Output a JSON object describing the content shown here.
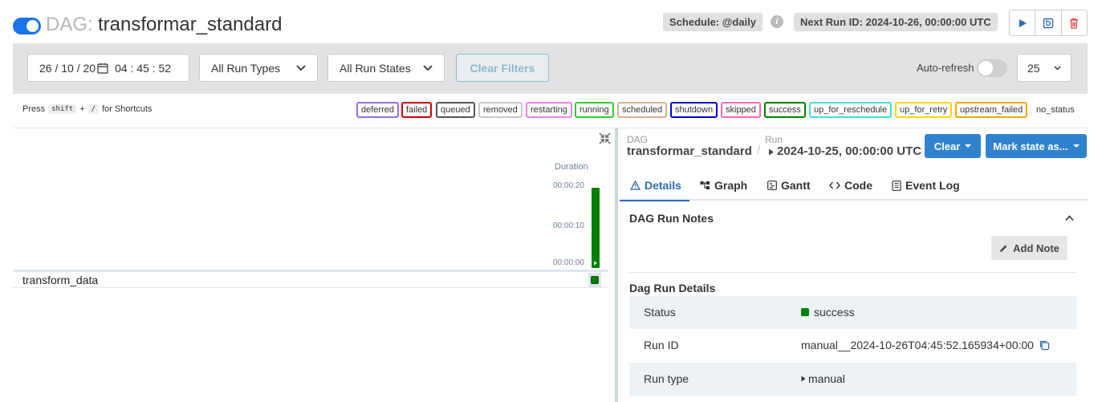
{
  "header": {
    "dag_prefix": "DAG:",
    "dag_id": "transformar_standard",
    "schedule": "Schedule: @daily",
    "next_run": "Next Run ID: 2024-10-26, 00:00:00 UTC",
    "actions": [
      "play-icon",
      "reparse-icon",
      "trash-icon"
    ]
  },
  "filters": {
    "date": "26 / 10 / 20",
    "time": "04 : 45 : 52",
    "run_types": "All Run Types",
    "run_states": "All Run States",
    "clear_filters": "Clear Filters",
    "auto_refresh_label": "Auto-refresh",
    "page_size": "25"
  },
  "shortcut": {
    "press": "Press",
    "key1": "shift",
    "plus": "+",
    "key2": "/",
    "suffix": "for Shortcuts"
  },
  "legend": [
    {
      "label": "deferred",
      "color": "#9370db"
    },
    {
      "label": "failed",
      "color": "#cc0000"
    },
    {
      "label": "queued",
      "color": "#555555"
    },
    {
      "label": "removed",
      "color": "#c8c8c8"
    },
    {
      "label": "restarting",
      "color": "#ee82ee"
    },
    {
      "label": "running",
      "color": "#32cd32"
    },
    {
      "label": "scheduled",
      "color": "#d2b48c"
    },
    {
      "label": "shutdown",
      "color": "#0000cc"
    },
    {
      "label": "skipped",
      "color": "#ff69b4"
    },
    {
      "label": "success",
      "color": "#008000"
    },
    {
      "label": "up_for_reschedule",
      "color": "#40e0d0"
    },
    {
      "label": "up_for_retry",
      "color": "#ffd700"
    },
    {
      "label": "upstream_failed",
      "color": "#ffa500"
    },
    {
      "label": "no_status",
      "color": ""
    }
  ],
  "grid": {
    "duration_label": "Duration",
    "ticks": [
      "00:00:20",
      "00:00:10",
      "00:00:00"
    ],
    "task_name": "transform_data"
  },
  "details": {
    "crumb_dag_label": "DAG",
    "crumb_dag_value": "transformar_standard",
    "crumb_run_label": "Run",
    "crumb_run_value": "2024-10-25, 00:00:00 UTC",
    "clear_btn": "Clear",
    "mark_btn": "Mark state as...",
    "tabs": [
      "Details",
      "Graph",
      "Gantt",
      "Code",
      "Event Log"
    ],
    "notes_title": "DAG Run Notes",
    "add_note": "Add Note",
    "run_details_title": "Dag Run Details",
    "rows": [
      {
        "key": "Status",
        "value": "success"
      },
      {
        "key": "Run ID",
        "value": "manual__2024-10-26T04:45:52.165934+00:00"
      },
      {
        "key": "Run type",
        "value": "manual"
      }
    ]
  }
}
